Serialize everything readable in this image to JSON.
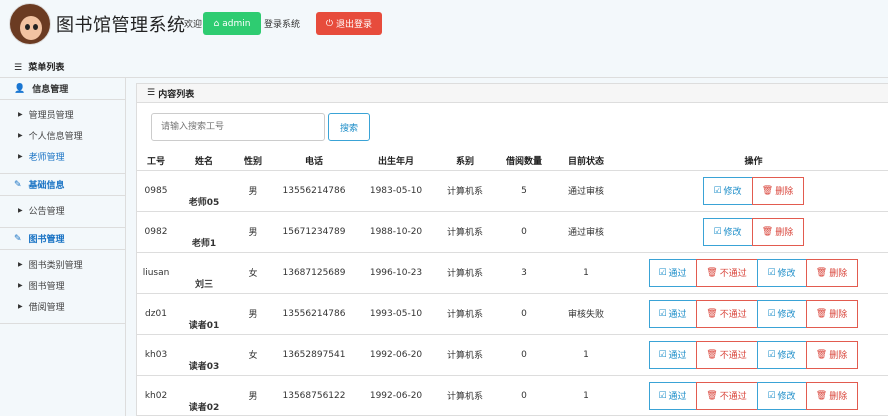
{
  "header": {
    "title": "图书馆管理系统",
    "welcome": "欢迎",
    "user_label": "admin",
    "login_text": "登录系统",
    "logout_label": "退出登录"
  },
  "menu_title": "菜单列表",
  "sidebar": {
    "sections": [
      {
        "title": "信息管理",
        "icon": "user-icon",
        "items": [
          "管理员管理",
          "个人信息管理",
          "老师管理"
        ]
      },
      {
        "title": "基础信息",
        "icon": "edit-icon",
        "items": [
          "公告管理"
        ]
      },
      {
        "title": "图书管理",
        "icon": "edit-icon",
        "items": [
          "图书类别管理",
          "图书管理",
          "借阅管理"
        ]
      }
    ],
    "active_item": "老师管理"
  },
  "content": {
    "panel_title": "内容列表",
    "search_placeholder": "请输入搜索工号",
    "search_label": "搜索",
    "columns": [
      "工号",
      "姓名",
      "性别",
      "电话",
      "出生年月",
      "系别",
      "借阅数量",
      "目前状态",
      "操作"
    ],
    "rows": [
      {
        "id": "0985",
        "name": "老师05",
        "gender": "男",
        "phone": "13556214786",
        "birth": "1983-05-10",
        "dept": "计算机系",
        "borrow": "5",
        "status": "通过审核",
        "actions": [
          "edit",
          "delete"
        ]
      },
      {
        "id": "0982",
        "name": "老师1",
        "gender": "男",
        "phone": "15671234789",
        "birth": "1988-10-20",
        "dept": "计算机系",
        "borrow": "0",
        "status": "通过审核",
        "actions": [
          "edit",
          "delete"
        ]
      },
      {
        "id": "liusan",
        "name": "刘三",
        "gender": "女",
        "phone": "13687125689",
        "birth": "1996-10-23",
        "dept": "计算机系",
        "borrow": "3",
        "status": "1",
        "actions": [
          "pass",
          "reject",
          "edit",
          "delete"
        ]
      },
      {
        "id": "dz01",
        "name": "读者01",
        "gender": "男",
        "phone": "13556214786",
        "birth": "1993-05-10",
        "dept": "计算机系",
        "borrow": "0",
        "status": "审核失败",
        "actions": [
          "pass",
          "reject",
          "edit",
          "delete"
        ]
      },
      {
        "id": "kh03",
        "name": "读者03",
        "gender": "女",
        "phone": "13652897541",
        "birth": "1992-06-20",
        "dept": "计算机系",
        "borrow": "0",
        "status": "1",
        "actions": [
          "pass",
          "reject",
          "edit",
          "delete"
        ]
      },
      {
        "id": "kh02",
        "name": "读者02",
        "gender": "男",
        "phone": "13568756122",
        "birth": "1992-06-20",
        "dept": "计算机系",
        "borrow": "0",
        "status": "1",
        "actions": [
          "pass",
          "reject",
          "edit",
          "delete"
        ]
      }
    ],
    "action_labels": {
      "pass": "通过",
      "reject": "不通过",
      "edit": "修改",
      "delete": "删除"
    }
  }
}
